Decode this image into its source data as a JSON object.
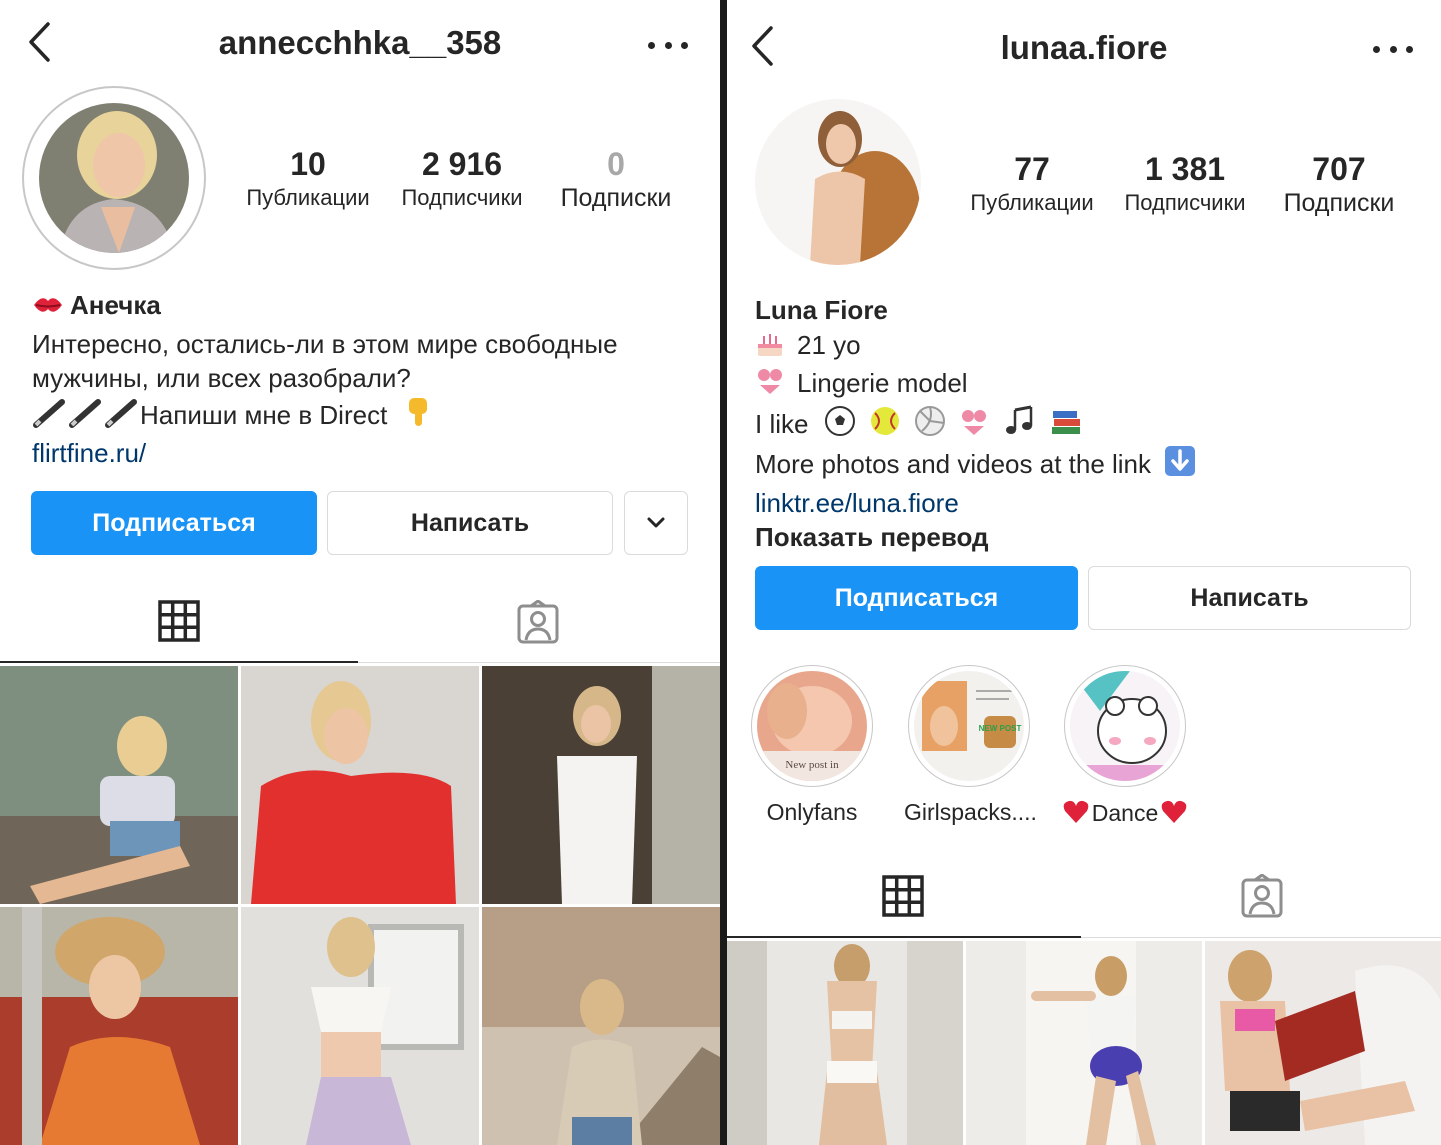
{
  "left_profile": {
    "username": "annecchhka__358",
    "stats": {
      "posts_count": "10",
      "posts_label": "Публикации",
      "followers_count": "2 916",
      "followers_label": "Подписчики",
      "following_count": "0",
      "following_label": "Подписки"
    },
    "bio": {
      "name": "Анечка",
      "line1": "Интересно, остались-ли в этом мире свободные",
      "line2": "мужчины, или всех разобрали?",
      "line3": "Напиши мне в Direct",
      "link": "flirtfine.ru/"
    },
    "buttons": {
      "follow": "Подписаться",
      "message": "Написать"
    },
    "tabs": {
      "grid_icon": "grid-icon",
      "tagged_icon": "tagged-icon"
    },
    "posts": 6
  },
  "right_profile": {
    "username": "lunaa.fiore",
    "stats": {
      "posts_count": "77",
      "posts_label": "Публикации",
      "followers_count": "1 381",
      "followers_label": "Подписчики",
      "following_count": "707",
      "following_label": "Подписки"
    },
    "bio": {
      "name": "Luna Fiore",
      "line1": "21 yo",
      "line2": "Lingerie model",
      "line3": "I like",
      "line4": "More photos and videos at the link",
      "link": "linktr.ee/luna.fiore",
      "translate": "Показать перевод"
    },
    "buttons": {
      "follow": "Подписаться",
      "message": "Написать"
    },
    "highlights": [
      {
        "label": "Onlyfans",
        "caption": "New post in"
      },
      {
        "label": "Girlspacks....",
        "badge": "NEW POST"
      },
      {
        "label": "Dance"
      }
    ],
    "posts": 3
  },
  "colors": {
    "primary_button": "#1993f5",
    "link": "#00376b",
    "text": "#262626",
    "border": "#dbdbdb"
  },
  "icons": [
    "back-arrow-icon",
    "more-options-icon",
    "kiss-emoji",
    "pen-emoji",
    "pointing-down-emoji",
    "cake-emoji",
    "bikini-emoji",
    "soccer-ball-emoji",
    "softball-emoji",
    "volleyball-emoji",
    "music-notes-emoji",
    "books-emoji",
    "down-arrow-emoji",
    "heart-emoji",
    "chevron-down-icon",
    "grid-icon",
    "tagged-icon"
  ]
}
